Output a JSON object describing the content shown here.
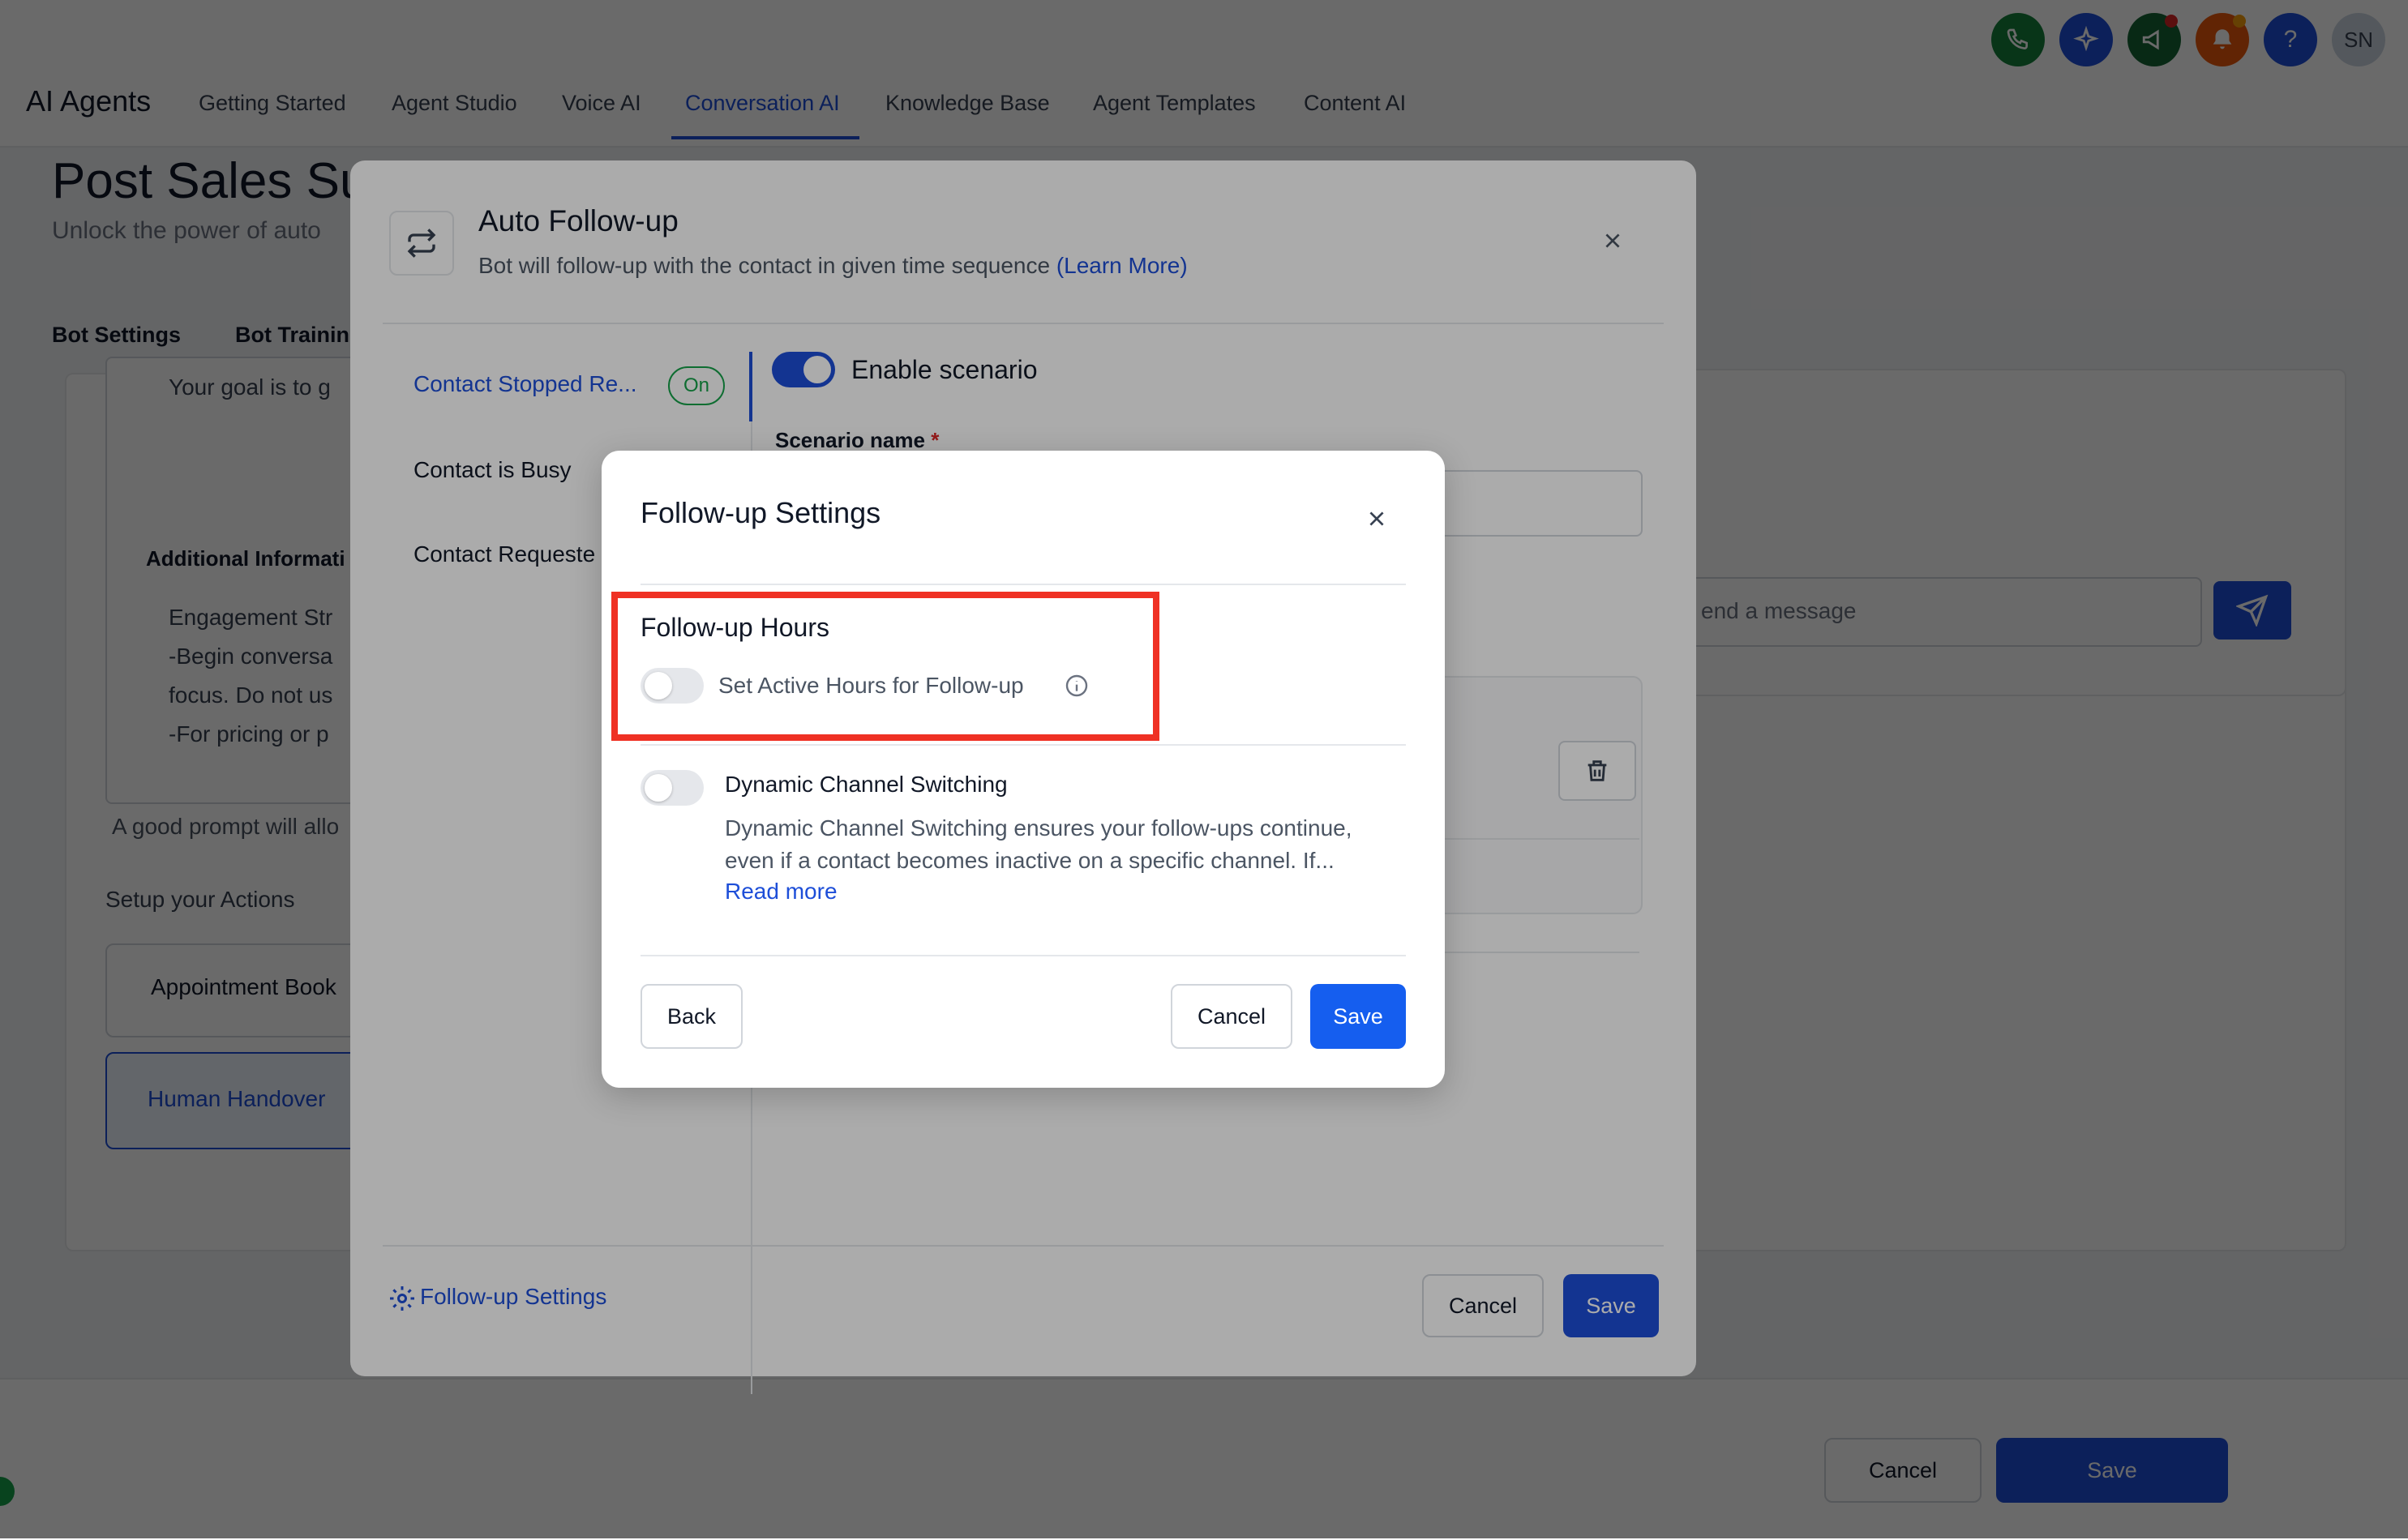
{
  "app": {
    "title": "AI Agents",
    "nav": [
      "Getting Started",
      "Agent Studio",
      "Voice AI",
      "Conversation AI",
      "Knowledge Base",
      "Agent Templates",
      "Content AI"
    ],
    "active_nav": "Conversation AI",
    "header_icons": [
      "phone-icon",
      "sparkle-icon",
      "megaphone-icon",
      "bell-icon",
      "help-icon"
    ],
    "avatar_initials": "SN",
    "colors": {
      "phone": "#15803d",
      "sparkle": "#1d4ed8",
      "megaphone": "#166534",
      "bell": "#ea580c",
      "help": "#1d4ed8",
      "accent": "#1d4ed8"
    }
  },
  "page": {
    "title": "Post Sales Su",
    "subtitle": "Unlock the power of auto",
    "tabs": [
      "Bot Settings",
      "Bot Trainin"
    ],
    "prompt_first_line": "Your goal is to g",
    "additional_info_label": "Additional Informati",
    "engagement_lines": [
      "Engagement Str",
      "-Begin conversa",
      "focus. Do not us",
      "-For pricing or p"
    ],
    "prompt_hint": "A good prompt will allo",
    "actions_title": "Setup your Actions",
    "actions": [
      "Appointment Book",
      "Human Handover"
    ],
    "chat_placeholder": "end a message",
    "footer_cancel": "Cancel",
    "footer_save": "Save"
  },
  "auto_followup": {
    "title": "Auto Follow-up",
    "subtitle": "Bot will follow-up with the contact in given time sequence",
    "learn_more": "(Learn More)",
    "scenarios": [
      "Contact Stopped Re...",
      "Contact is Busy",
      "Contact Requeste"
    ],
    "active_scenario_badge": "On",
    "enable_scenario_label": "Enable scenario",
    "enable_scenario_on": true,
    "scenario_name_label": "Scenario name",
    "required_mark": "*",
    "footer_link": "Follow-up Settings",
    "cancel_label": "Cancel",
    "save_label": "Save"
  },
  "followup_settings": {
    "title": "Follow-up Settings",
    "hours_section_title": "Follow-up Hours",
    "active_hours_label": "Set Active Hours for Follow-up",
    "active_hours_enabled": false,
    "dynamic_switching_title": "Dynamic Channel Switching",
    "dynamic_switching_desc": "Dynamic Channel Switching ensures your follow-ups continue, even if a contact becomes inactive on a specific channel. If...",
    "dynamic_switching_enabled": false,
    "read_more": "Read more",
    "back_label": "Back",
    "cancel_label": "Cancel",
    "save_label": "Save",
    "highlight_color": "#ef3124"
  }
}
